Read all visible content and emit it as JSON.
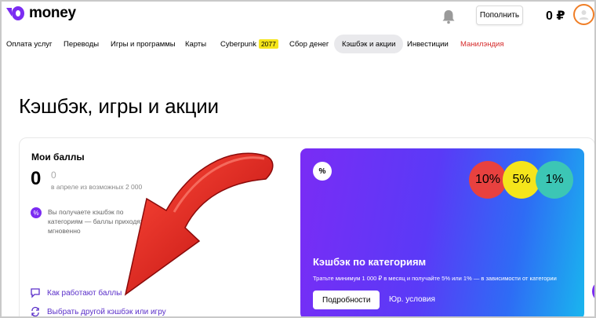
{
  "header": {
    "logo_text": "money",
    "topup_label": "Пополнить",
    "balance": "0 ₽",
    "icons": [
      "bell-icon",
      "avatar-icon"
    ],
    "avatar_ring_color": "#f07e26"
  },
  "nav": {
    "items": [
      {
        "label": "Оплата услуг"
      },
      {
        "label": "Переводы"
      },
      {
        "label": "Игры и программы"
      },
      {
        "label": "Карты"
      },
      {
        "label": "Cyberpunk",
        "badge": "2077"
      },
      {
        "label": "Сбор денег"
      },
      {
        "label": "Кэшбэк и акции",
        "active": true
      },
      {
        "label": "Инвестиции"
      },
      {
        "label": "Манилэндия",
        "color": "#d62b2b"
      }
    ]
  },
  "page": {
    "title": "Кэшбэк, игры и акции"
  },
  "points": {
    "title": "Мои баллы",
    "value": "0",
    "possible_value": "0",
    "possible_caption": "в апреле из возможных 2 000",
    "info_text": "Вы получаете кэшбэк по категориям — баллы приходят мгновенно",
    "links": [
      {
        "label": "Как работают баллы",
        "icon": "chat-icon"
      },
      {
        "label": "Выбрать другой кэшбэк или игру",
        "icon": "refresh-icon"
      }
    ]
  },
  "promo": {
    "badge": "%",
    "circles": [
      {
        "label": "10%",
        "color": "#e8413f"
      },
      {
        "label": "5%",
        "color": "#f5e51b"
      },
      {
        "label": "1%",
        "color": "#3cc6b5"
      }
    ],
    "title": "Кэшбэк по категориям",
    "subtitle": "Тратьте минимум 1 000 ₽ в месяц и получайте 5% или 1% — в зависимости от категории",
    "button_label": "Подробности",
    "link_label": "Юр. условия"
  },
  "colors": {
    "accent": "#7b2cf2",
    "arrow": "#e01515"
  }
}
